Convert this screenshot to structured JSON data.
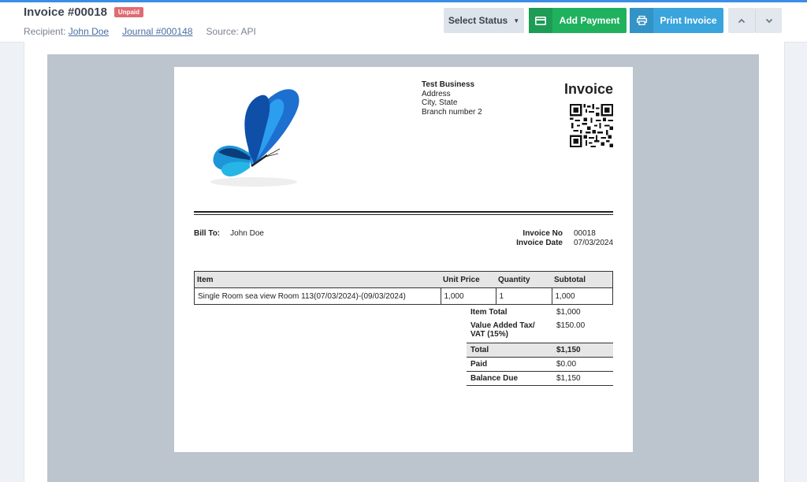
{
  "header": {
    "title": "Invoice #00018",
    "badge": "Unpaid",
    "recipient_label": "Recipient:",
    "recipient_link": "John Doe",
    "journal_link": "Journal #000148",
    "source": "Source: API"
  },
  "toolbar": {
    "select_status": "Select Status",
    "add_payment": "Add Payment",
    "print_invoice": "Print Invoice",
    "colors": {
      "add_payment": "#20b15f",
      "print_invoice": "#3aa4dd",
      "badge": "#e06b73"
    }
  },
  "invoice": {
    "business": {
      "name": "Test Business",
      "address": "Address",
      "city": "City, State",
      "branch": "Branch number 2"
    },
    "doc_title": "Invoice",
    "bill_to_label": "Bill To:",
    "bill_to_name": "John Doe",
    "invoice_no_label": "Invoice No",
    "invoice_no": "00018",
    "invoice_date_label": "Invoice Date",
    "invoice_date": "07/03/2024",
    "columns": [
      "Item",
      "Unit Price",
      "Quantity",
      "Subtotal"
    ],
    "rows": [
      {
        "item": "Single Room sea view Room 113(07/03/2024)-(09/03/2024)",
        "unit_price": "1,000",
        "quantity": "1",
        "subtotal": "1,000"
      }
    ],
    "totals": [
      {
        "label": "Item Total",
        "value": "$1,000"
      },
      {
        "label": "Value Added Tax/ VAT (15%)",
        "value": "$150.00"
      },
      {
        "label": "Total",
        "value": "$1,150"
      },
      {
        "label": "Paid",
        "value": "$0.00"
      },
      {
        "label": "Balance Due",
        "value": "$1,150"
      }
    ]
  }
}
